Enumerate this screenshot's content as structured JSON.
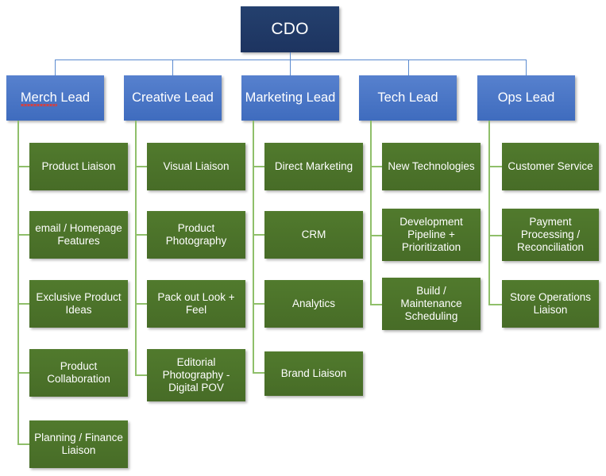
{
  "colors": {
    "root_box": "#1F3864",
    "lead_box": "#4472C4",
    "leaf_box": "#4F7A28",
    "blue_connector": "#5B8BD0",
    "green_connector": "#8FBF6A",
    "text": "#FFFFFF",
    "spellcheck_underline": "#E8392F",
    "background": "#FFFFFF"
  },
  "root": {
    "label": "CDO"
  },
  "columns": [
    {
      "lead": "Merch Lead",
      "lead_misspelled_word": "Merch",
      "lead_rest": " Lead",
      "reports": [
        "Product Liaison",
        "email / Homepage Features",
        "Exclusive Product Ideas",
        "Product Collaboration",
        "Planning / Finance Liaison"
      ]
    },
    {
      "lead": "Creative Lead",
      "reports": [
        "Visual Liaison",
        "Product Photography",
        "Pack out Look + Feel",
        "Editorial Photography - Digital POV"
      ]
    },
    {
      "lead": "Marketing Lead",
      "reports": [
        "Direct Marketing",
        "CRM",
        "Analytics",
        "Brand Liaison"
      ]
    },
    {
      "lead": "Tech Lead",
      "reports": [
        "New Technologies",
        "Development Pipeline + Prioritization",
        "Build / Maintenance Scheduling"
      ]
    },
    {
      "lead": "Ops Lead",
      "reports": [
        "Customer Service",
        "Payment Processing / Reconciliation",
        "Store Operations Liaison"
      ]
    }
  ]
}
